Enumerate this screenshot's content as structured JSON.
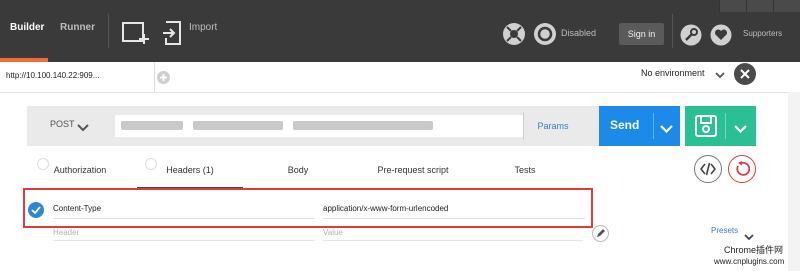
{
  "topbar": {
    "builder": "Builder",
    "runner": "Runner",
    "import": "Import",
    "disabled": "Disabled",
    "signin": "Sign in",
    "supporters": "Supporters"
  },
  "urlbar": {
    "tab_url": "http://10.100.140.22:909...",
    "environment": "No environment"
  },
  "request": {
    "method": "POST",
    "params": "Params",
    "send": "Send"
  },
  "subtabs": {
    "authorization": "Authorization",
    "headers": "Headers (1)",
    "body": "Body",
    "prerequest": "Pre-request script",
    "tests": "Tests"
  },
  "headers": {
    "key": "Content-Type",
    "value": "application/x-www-form-urlencoded",
    "key_placeholder": "Header",
    "value_placeholder": "Value",
    "presets": "Presets"
  },
  "watermark": {
    "line1": "Chrome插件网",
    "line2": "www.cnplugins.com"
  },
  "colors": {
    "topbar": "#3a3a3a",
    "accent_orange": "#f26b3a",
    "send_blue": "#1b8ae8",
    "save_green": "#2bbf95",
    "highlight_red": "#e23b3b",
    "link_blue": "#3a7bd5"
  }
}
